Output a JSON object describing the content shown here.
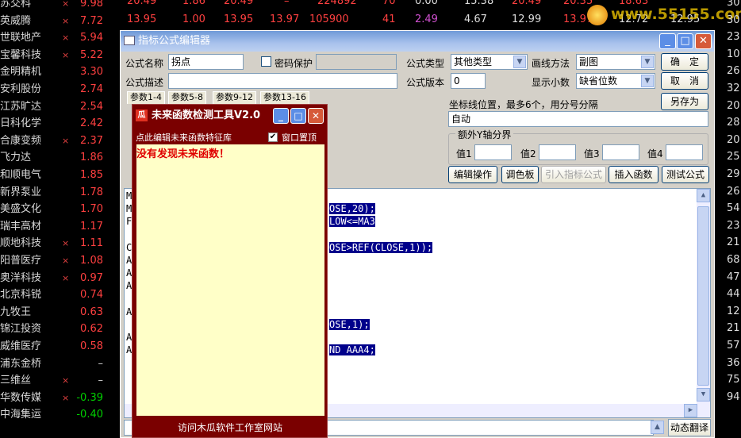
{
  "stocks": [
    {
      "name": "苏交科",
      "mark": "×",
      "price": "9.98",
      "dir": "up"
    },
    {
      "name": "英威腾",
      "mark": "×",
      "price": "7.72",
      "dir": "up"
    },
    {
      "name": "世联地产",
      "mark": "×",
      "price": "5.94",
      "dir": "up"
    },
    {
      "name": "宝馨科技",
      "mark": "×",
      "price": "5.22",
      "dir": "up"
    },
    {
      "name": "金明精机",
      "mark": "",
      "price": "3.30",
      "dir": "up"
    },
    {
      "name": "安利股份",
      "mark": "",
      "price": "2.74",
      "dir": "up"
    },
    {
      "name": "江苏旷达",
      "mark": "",
      "price": "2.54",
      "dir": "up"
    },
    {
      "name": "日科化学",
      "mark": "",
      "price": "2.42",
      "dir": "up"
    },
    {
      "name": "合康变频",
      "mark": "×",
      "price": "2.37",
      "dir": "up"
    },
    {
      "name": "飞力达",
      "mark": "",
      "price": "1.86",
      "dir": "up"
    },
    {
      "name": "和顺电气",
      "mark": "",
      "price": "1.85",
      "dir": "up"
    },
    {
      "name": "新界泵业",
      "mark": "",
      "price": "1.78",
      "dir": "up"
    },
    {
      "name": "美盛文化",
      "mark": "",
      "price": "1.70",
      "dir": "up"
    },
    {
      "name": "瑞丰高材",
      "mark": "",
      "price": "1.17",
      "dir": "up"
    },
    {
      "name": "顺地科技",
      "mark": "×",
      "price": "1.11",
      "dir": "up"
    },
    {
      "name": "阳普医疗",
      "mark": "×",
      "price": "1.08",
      "dir": "up"
    },
    {
      "name": "奥洋科技",
      "mark": "×",
      "price": "0.97",
      "dir": "up"
    },
    {
      "name": "北京科锐",
      "mark": "",
      "price": "0.74",
      "dir": "up"
    },
    {
      "name": "九牧王",
      "mark": "",
      "price": "0.63",
      "dir": "up"
    },
    {
      "name": "锦江投资",
      "mark": "",
      "price": "0.62",
      "dir": "up"
    },
    {
      "name": "威维医疗",
      "mark": "",
      "price": "0.58",
      "dir": "up"
    },
    {
      "name": "浦东金桥",
      "mark": "",
      "price": "–",
      "dir": "fl"
    },
    {
      "name": "三维丝",
      "mark": "×",
      "price": "–",
      "dir": "fl"
    },
    {
      "name": "华数传媒",
      "mark": "×",
      "price": "-0.39",
      "dir": "dn"
    },
    {
      "name": "中海集运",
      "mark": "",
      "price": "-0.40",
      "dir": "dn"
    }
  ],
  "right_column": [
    "30",
    "30",
    "23",
    "101",
    "26",
    "32",
    "20",
    "28",
    "20",
    "25",
    "29",
    "26",
    "54",
    "23",
    "21",
    "68",
    "47",
    "44",
    "12",
    "21",
    "57",
    "36",
    "75",
    "94"
  ],
  "top_rows": [
    [
      "20.49",
      "1.86",
      "20.49",
      "–",
      "224892",
      "70",
      "0.00",
      "15.38",
      "20.49",
      "20.35",
      "18.63"
    ],
    [
      "13.95",
      "1.00",
      "13.95",
      "13.97",
      "105900",
      "41",
      "2.49",
      "4.67",
      "12.99",
      "13.97",
      "12.72",
      "12.95"
    ]
  ],
  "watermark": "www.55155.com",
  "editor": {
    "title": "指标公式编辑器",
    "formula_name_label": "公式名称",
    "formula_name": "拐点",
    "password_label": "密码保护",
    "desc_label": "公式描述",
    "desc": "",
    "type_label": "公式类型",
    "type_value": "其他类型",
    "draw_label": "画线方法",
    "draw_value": "副图",
    "version_label": "公式版本",
    "version_value": "0",
    "decimal_label": "显示小数",
    "decimal_value": "缺省位数",
    "ok": "确　定",
    "cancel": "取　消",
    "save_as": "另存为",
    "tabs": [
      "参数1-4",
      "参数5-8",
      "参数9-12",
      "参数13-16"
    ],
    "coord_label": "坐标线位置，最多6个，用分号分隔",
    "coord_value": "自动",
    "yaxis_group": "额外Y轴分界",
    "y_labels": [
      "值1",
      "值2",
      "值3",
      "值4"
    ],
    "buttons": [
      "编辑操作",
      "调色板",
      "引入指标公式",
      "插入函数",
      "测试公式"
    ],
    "dynamic_translate": "动态翻译"
  },
  "code_lines": [
    {
      "left": "M",
      "right": "",
      "hl": false
    },
    {
      "left": "M",
      "right": "OSE,20);",
      "hl": true
    },
    {
      "left": "F",
      "right": "LOW<=MA3",
      "hl": true
    },
    {
      "left": "",
      "right": "",
      "hl": false
    },
    {
      "left": "C",
      "right": "OSE>REF(CLOSE,1));",
      "hl": true
    },
    {
      "left": "A",
      "right": "",
      "hl": false
    },
    {
      "left": "A",
      "right": "",
      "hl": false
    },
    {
      "left": "A",
      "right": "",
      "hl": false
    },
    {
      "left": "",
      "right": "",
      "hl": false
    },
    {
      "left": "A",
      "right": "",
      "hl": false
    },
    {
      "left": "",
      "right": "OSE,1);",
      "hl": true
    },
    {
      "left": "A",
      "right": "",
      "hl": false
    },
    {
      "left": "A",
      "right": "ND AAA4;",
      "hl": true
    }
  ],
  "popup": {
    "title": "未来函数检测工具V2.0",
    "icon_text": "瓜",
    "link_text": "点此编辑未来函数特征库",
    "ontop_label": "窗口置顶",
    "result": "没有发现未来函数！",
    "footer": "访问木瓜软件工作室网站"
  },
  "colors": {
    "up": "#ff4040",
    "down": "#00d000",
    "titlebar": "#7fa6e0",
    "popup_bg": "#7a0000",
    "popup_body": "#ffffc8"
  }
}
